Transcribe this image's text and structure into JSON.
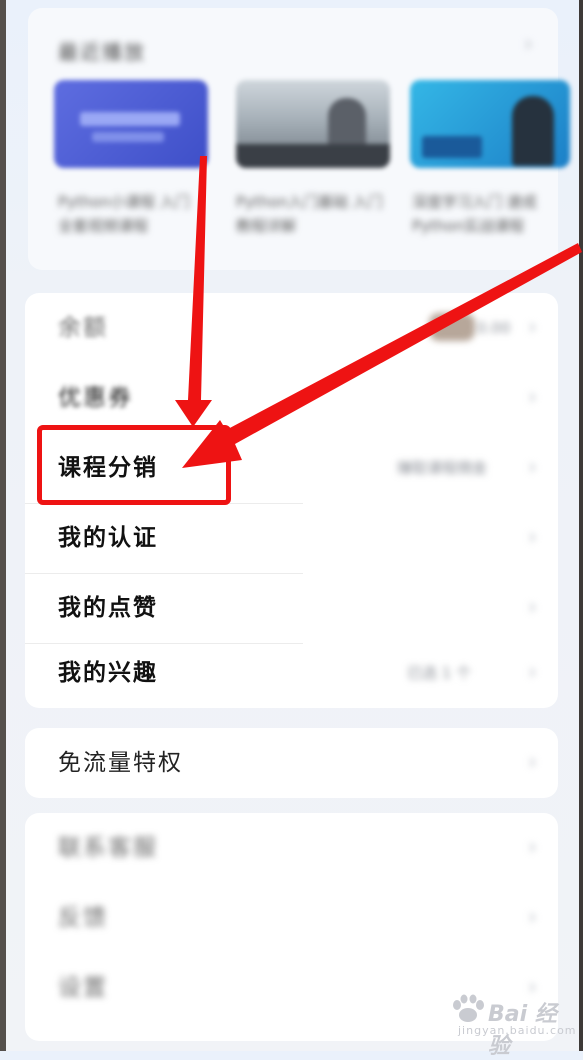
{
  "recent_section": {
    "title": "最近播放",
    "captions": [
      "Python小课程 入门 全套视频课程",
      "Python入门基础 入门 教程详解",
      "深度学习入门 速成Python实战课程"
    ]
  },
  "menu": {
    "items": [
      {
        "label": "余额",
        "value": "0.00"
      },
      {
        "label": "优惠券",
        "value": ""
      },
      {
        "label": "课程分销",
        "value": "赚取课程佣金"
      },
      {
        "label": "我的认证",
        "value": ""
      },
      {
        "label": "我的点赞",
        "value": ""
      },
      {
        "label": "我的兴趣",
        "value": "已选 1 个"
      }
    ]
  },
  "flow_privilege": {
    "label": "免流量特权"
  },
  "bottom_menu": {
    "items": [
      {
        "label": "联系客服"
      },
      {
        "label": "反馈"
      },
      {
        "label": "设置"
      }
    ]
  },
  "watermark": {
    "brand": "Bai 经验",
    "sub": "jingyan.baidu.com"
  },
  "colors": {
    "annotation_red": "#ee1313",
    "background": "#eef2f8"
  }
}
